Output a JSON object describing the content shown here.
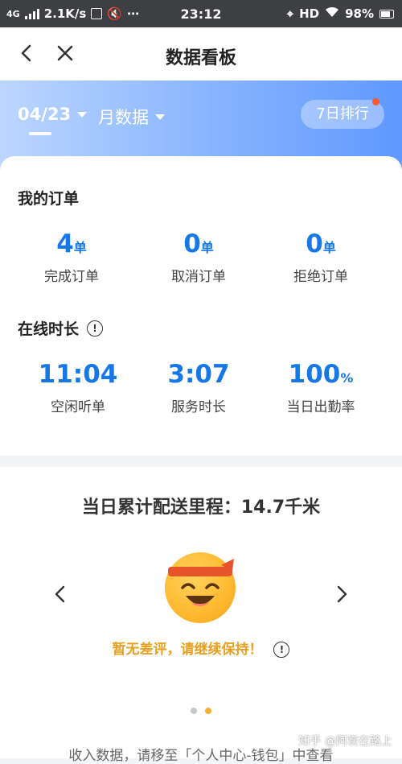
{
  "status_bar": {
    "network": "4G",
    "speed": "2.1K/s",
    "extra": "⋯",
    "time": "23:12",
    "hd": "HD",
    "battery": "98%"
  },
  "nav": {
    "title": "数据看板"
  },
  "header": {
    "date": "04/23",
    "period": "月数据",
    "rank_label": "7日排行"
  },
  "orders": {
    "title": "我的订单",
    "items": [
      {
        "value": "4",
        "unit": "单",
        "label": "完成订单"
      },
      {
        "value": "0",
        "unit": "单",
        "label": "取消订单"
      },
      {
        "value": "0",
        "unit": "单",
        "label": "拒绝订单"
      }
    ]
  },
  "online": {
    "title": "在线时长",
    "items": [
      {
        "value": "11:04",
        "unit": "",
        "label": "空闲听单"
      },
      {
        "value": "3:07",
        "unit": "",
        "label": "服务时长"
      },
      {
        "value": "100",
        "unit": "%",
        "label": "当日出勤率"
      }
    ]
  },
  "mileage": {
    "headline": "当日累计配送里程：14.7千米",
    "message": "暂无差评，请继续保持！",
    "page_count": 2,
    "active_page": 2,
    "footer": "收入数据，请移至「个人中心-钱包」中查看",
    "watermark": "知乎 @阿炭在路上"
  },
  "colors": {
    "accent_blue": "#1677e6",
    "message_orange": "#e8a020",
    "badge_red": "#ff5a2d"
  }
}
